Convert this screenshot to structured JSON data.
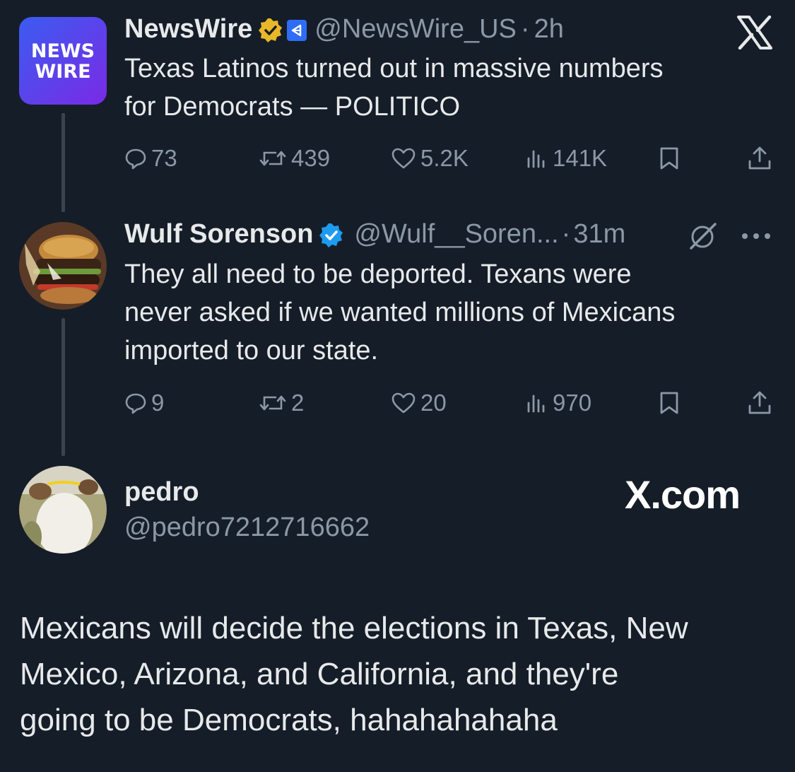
{
  "close_logo": "x-logo",
  "newswire": {
    "avatar_text_line1": "NEWS",
    "avatar_text_line2": "WIRE",
    "name": "NewsWire",
    "handle": "@NewsWire_US",
    "dot": "·",
    "time": "2h",
    "text_line1": "Texas Latinos turned out in massive numbers",
    "text_line2": "for Democrats — POLITICO",
    "replies": "73",
    "reposts": "439",
    "likes": "5.2K",
    "views": "141K"
  },
  "wulf": {
    "name": "Wulf Sorenson",
    "handle": "@Wulf__Soren...",
    "dot": "·",
    "time": "31m",
    "text_line1": "They all need to be deported. Texans were",
    "text_line2": "never asked if we wanted millions of Mexicans",
    "text_line3": "imported to our state.",
    "replies": "9",
    "reposts": "2",
    "likes": "20",
    "views": "970"
  },
  "pedro": {
    "name": "pedro",
    "handle": "@pedro7212716662",
    "site": "X.com",
    "text_line1": "Mexicans will decide the elections in Texas, New",
    "text_line2": "Mexico, Arizona, and California, and they're",
    "text_line3": "going to be Democrats, hahahahahaha"
  },
  "colors": {
    "background": "#151d28",
    "text": "#e7e9ea",
    "muted": "#8b98a5",
    "verified_blue": "#1d9bf0",
    "verified_gold": "#e8b829"
  }
}
